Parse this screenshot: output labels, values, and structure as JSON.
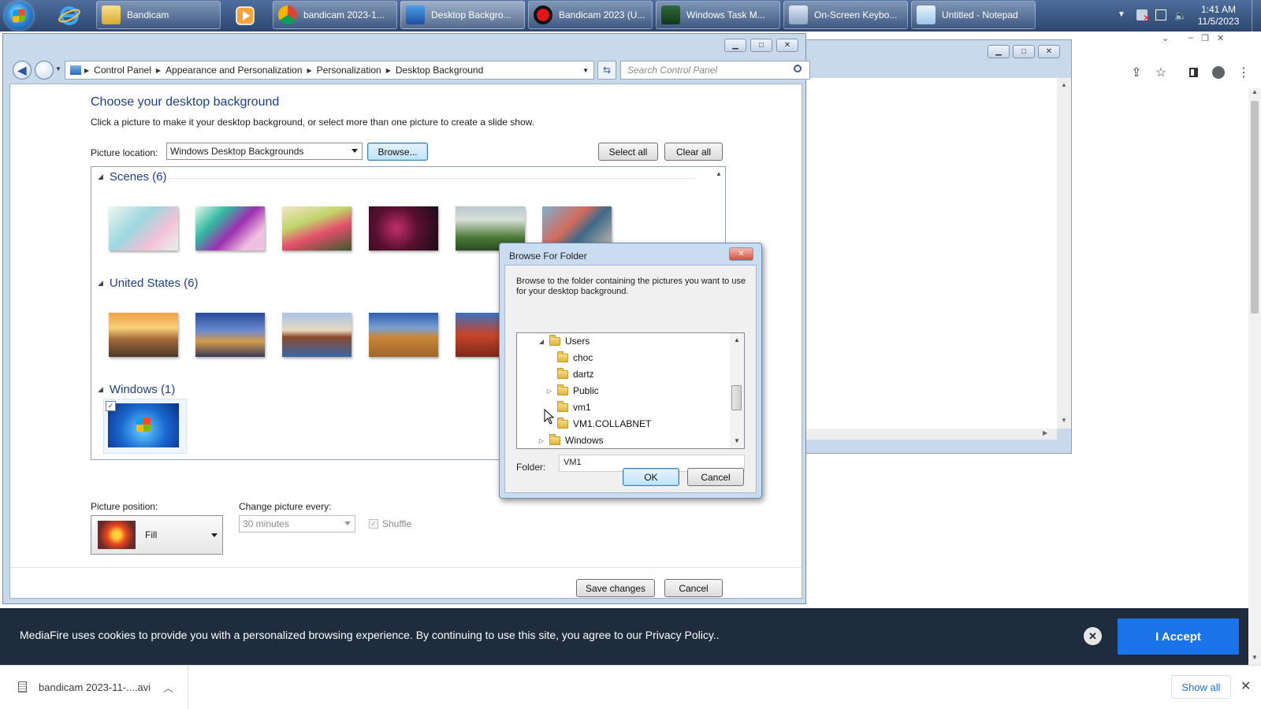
{
  "taskbar": {
    "buttons": [
      {
        "label": "Bandicam"
      },
      {
        "label": "bandicam 2023-1..."
      },
      {
        "label": "Desktop Backgro..."
      },
      {
        "label": "Bandicam 2023 (U..."
      },
      {
        "label": "Windows Task M..."
      },
      {
        "label": "On-Screen Keybo..."
      },
      {
        "label": "Untitled - Notepad"
      }
    ],
    "clock": {
      "time": "1:41 AM",
      "date": "11/5/2023"
    }
  },
  "control_panel": {
    "breadcrumb": [
      "Control Panel",
      "Appearance and Personalization",
      "Personalization",
      "Desktop Background"
    ],
    "search_placeholder": "Search Control Panel",
    "title": "Choose your desktop background",
    "subtitle": "Click a picture to make it your desktop background, or select more than one picture to create a slide show.",
    "picture_location_label": "Picture location:",
    "picture_location_value": "Windows Desktop Backgrounds",
    "browse_label": "Browse...",
    "select_all_label": "Select all",
    "clear_all_label": "Clear all",
    "groups": [
      {
        "name": "Scenes (6)"
      },
      {
        "name": "United States (6)"
      },
      {
        "name": "Windows (1)"
      }
    ],
    "picture_position_label": "Picture position:",
    "picture_position_value": "Fill",
    "change_picture_label": "Change picture every:",
    "change_picture_value": "30 minutes",
    "shuffle_label": "Shuffle",
    "save_label": "Save changes",
    "cancel_label": "Cancel"
  },
  "dialog": {
    "title": "Browse For Folder",
    "instructions": "Browse to the folder containing the pictures you want to use for your desktop background.",
    "tree": [
      {
        "label": "Users"
      },
      {
        "label": "choc"
      },
      {
        "label": "dartz"
      },
      {
        "label": "Public"
      },
      {
        "label": "vm1"
      },
      {
        "label": "VM1.COLLABNET"
      },
      {
        "label": "Windows"
      }
    ],
    "folder_label": "Folder:",
    "folder_value": "VM1",
    "ok_label": "OK",
    "cancel_label": "Cancel"
  },
  "cookie_banner": {
    "text": "MediaFire uses cookies to provide you with a personalized browsing experience. By continuing to use this site, you agree to our Privacy Policy..",
    "accept_label": "I Accept"
  },
  "download_bar": {
    "file_name": "bandicam 2023-11-....avi",
    "show_all_label": "Show all"
  },
  "colors": {
    "accent": "#1a73e8",
    "link_blue": "#1e3f8a",
    "banner_bg": "#1f2c3d"
  }
}
